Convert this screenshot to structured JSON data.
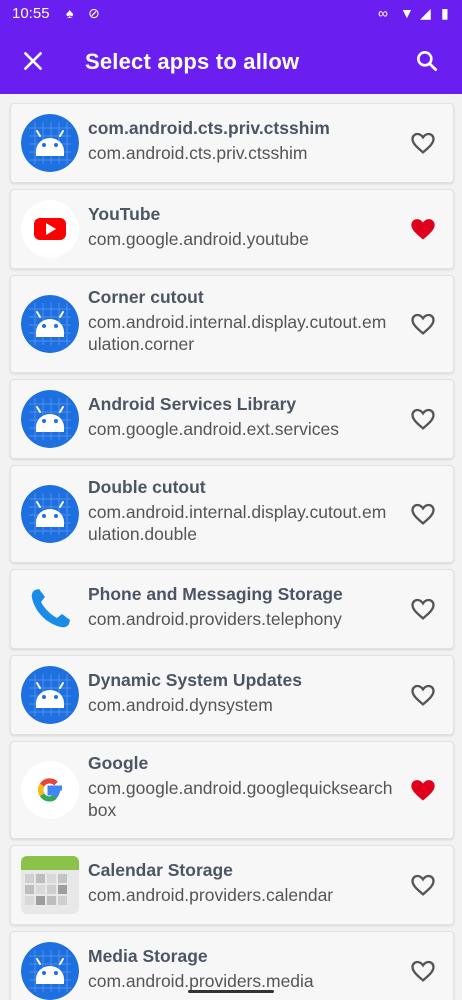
{
  "status_bar": {
    "time": "10:55"
  },
  "app_bar": {
    "title": "Select apps to allow"
  },
  "colors": {
    "primary": "#6a1ff0",
    "android_blue": "#1e6fe0",
    "heart_red": "#e0001b",
    "heart_outline": "#555555"
  },
  "apps": [
    {
      "name": "com.android.cts.priv.ctsshim",
      "package": "com.android.cts.priv.ctsshim",
      "icon": "android-icon",
      "favorite": false
    },
    {
      "name": "YouTube",
      "package": "com.google.android.youtube",
      "icon": "youtube-icon",
      "favorite": true
    },
    {
      "name": "Corner cutout",
      "package": "com.android.internal.display.cutout.emulation.corner",
      "icon": "android-icon",
      "favorite": false
    },
    {
      "name": "Android Services Library",
      "package": "com.google.android.ext.services",
      "icon": "android-icon",
      "favorite": false
    },
    {
      "name": "Double cutout",
      "package": "com.android.internal.display.cutout.emulation.double",
      "icon": "android-icon",
      "favorite": false
    },
    {
      "name": "Phone and Messaging Storage",
      "package": "com.android.providers.telephony",
      "icon": "phone-icon",
      "favorite": false
    },
    {
      "name": "Dynamic System Updates",
      "package": "com.android.dynsystem",
      "icon": "android-icon",
      "favorite": false
    },
    {
      "name": "Google",
      "package": "com.google.android.googlequicksearchbox",
      "icon": "google-icon",
      "favorite": true
    },
    {
      "name": "Calendar Storage",
      "package": "com.android.providers.calendar",
      "icon": "calendar-storage-icon",
      "favorite": false
    },
    {
      "name": "Media Storage",
      "package": "com.android.providers.media",
      "icon": "android-icon",
      "favorite": false
    }
  ]
}
